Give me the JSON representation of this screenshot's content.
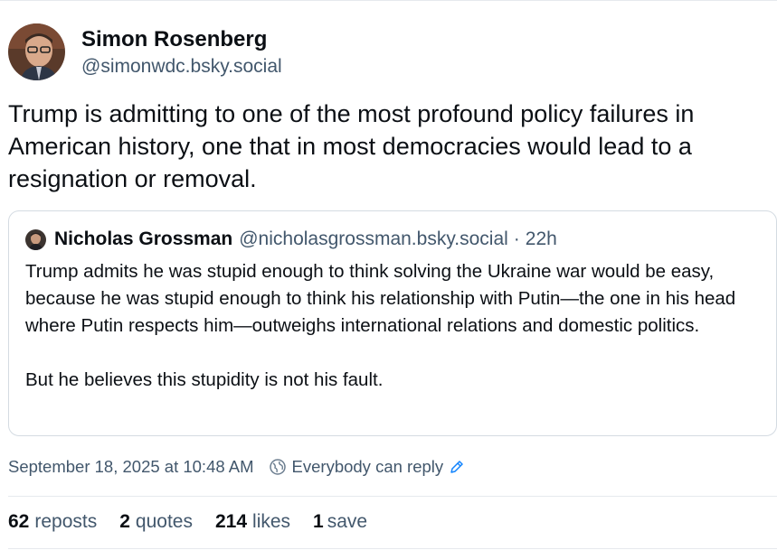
{
  "post": {
    "author": {
      "name": "Simon Rosenberg",
      "handle": "@simonwdc.bsky.social"
    },
    "text": "Trump is admitting to one of the most profound policy failures in American history, one that in most democracies would lead to a resignation or removal.",
    "quote": {
      "author_name": "Nicholas Grossman",
      "author_handle": "@nicholasgrossman.bsky.social",
      "separator": "·",
      "time": "22h",
      "paragraph1": "Trump admits he was stupid enough to think solving the Ukraine war would be easy, because he was stupid enough to think his relationship with Putin—the one in his head where Putin respects him—outweighs international relations and domestic politics.",
      "paragraph2": "But he believes this stupidity is not his fault."
    },
    "timestamp": "September 18, 2025 at 10:48 AM",
    "reply_setting": "Everybody can reply",
    "stats": {
      "reposts": {
        "count": "62",
        "label": "reposts"
      },
      "quotes": {
        "count": "2",
        "label": "quotes"
      },
      "likes": {
        "count": "214",
        "label": "likes"
      },
      "saves": {
        "count": "1",
        "label": "save"
      }
    }
  },
  "colors": {
    "text_primary": "#0b0f14",
    "text_secondary": "#42576c",
    "accent": "#1083fe",
    "border": "#d4dbe2"
  },
  "icons": {
    "reply_setting": "globe-icon",
    "edit": "pencil-icon"
  }
}
